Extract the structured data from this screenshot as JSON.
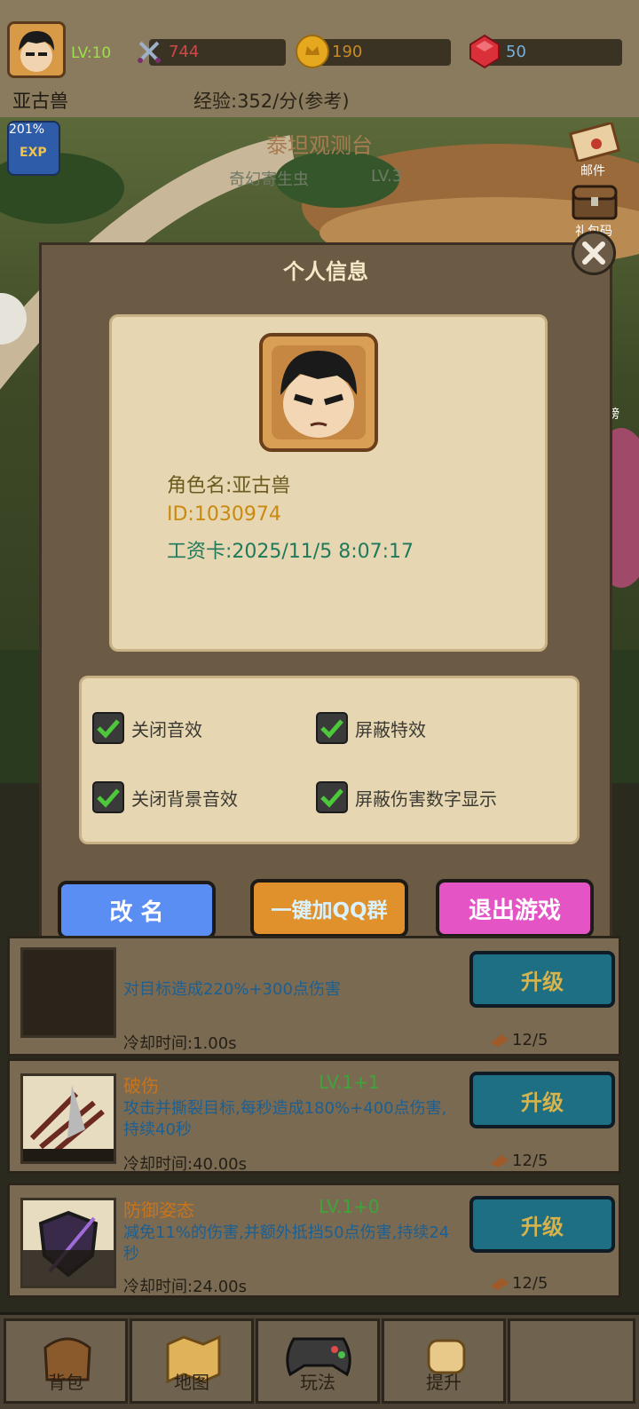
{
  "header": {
    "player_name": "亚古兽",
    "level": "LV:10",
    "attack": "744",
    "gold": "190",
    "gems": "50",
    "exp_rate": "经验:352/分(参考)",
    "exp_boost": "201%",
    "exp_label": "EXP"
  },
  "scene": {
    "location_title": "泰坦观测台",
    "monster_name": "奇幻寄生虫",
    "monster_level": "LV.3",
    "side_menu": {
      "mail": "邮件",
      "gift_code": "礼包码",
      "rank": "榜"
    }
  },
  "dialog": {
    "title": "个人信息",
    "character_name": "角色名:亚古兽",
    "id": "ID:1030974",
    "salary_card": "工资卡:2025/11/5 8:07:17",
    "settings": [
      {
        "label": "关闭音效",
        "checked": true
      },
      {
        "label": "屏蔽特效",
        "checked": true
      },
      {
        "label": "关闭背景音效",
        "checked": true
      },
      {
        "label": "屏蔽伤害数字显示",
        "checked": true
      }
    ],
    "buttons": {
      "rename": "改 名",
      "join_qq": "一键加QQ群",
      "exit": "退出游戏"
    }
  },
  "skills": [
    {
      "name": "",
      "level": "",
      "desc": "对目标造成220%+300点伤害",
      "cooldown": "冷却时间:1.00s",
      "upgrade": "升级",
      "books": "12/5"
    },
    {
      "name": "破伤",
      "level": "LV.1+1",
      "desc": "攻击并撕裂目标,每秒造成180%+400点伤害,持续40秒",
      "cooldown": "冷却时间:40.00s",
      "upgrade": "升级",
      "books": "12/5"
    },
    {
      "name": "防御姿态",
      "level": "LV.1+0",
      "desc": "减免11%的伤害,并额外抵挡50点伤害,持续24秒",
      "cooldown": "冷却时间:24.00s",
      "upgrade": "升级",
      "books": "12/5"
    }
  ],
  "nav": [
    {
      "label": "背包",
      "icon": "bag-icon"
    },
    {
      "label": "地图",
      "icon": "map-icon"
    },
    {
      "label": "玩法",
      "icon": "gamepad-icon"
    },
    {
      "label": "提升",
      "icon": "fist-icon"
    },
    {
      "label": "",
      "icon": ""
    }
  ],
  "colors": {
    "rename_button": "#5b8ef2",
    "qq_button": "#e1912b",
    "exit_button": "#e454c4",
    "upgrade_button": "#1f6f84"
  }
}
